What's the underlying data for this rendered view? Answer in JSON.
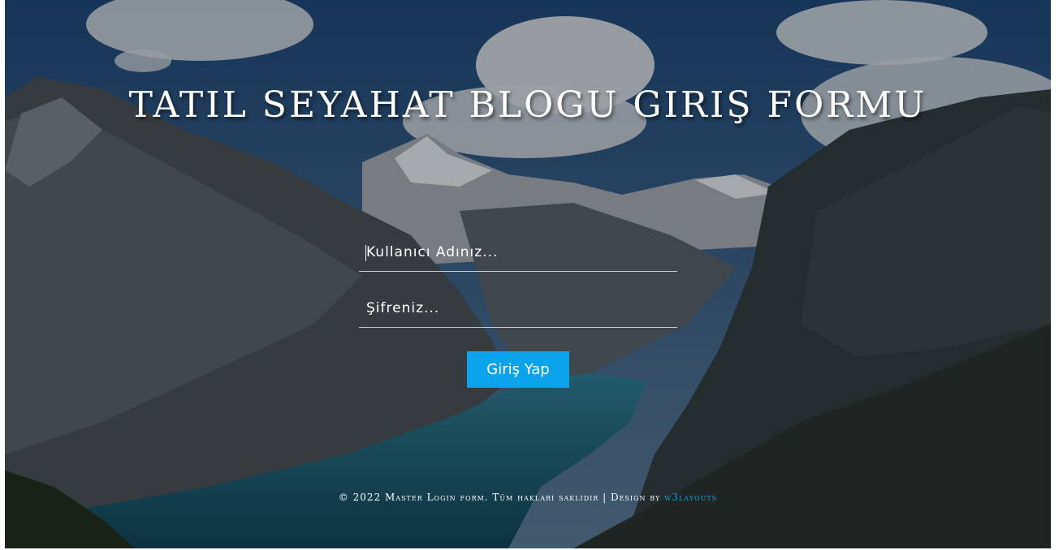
{
  "page": {
    "title": "TATIL SEYAHAT BLOGU GIRIŞ FORMU"
  },
  "login_form": {
    "username_placeholder": "Kullanıcı Adınız...",
    "password_placeholder": "Şifreniz...",
    "submit_label": "Giriş Yap"
  },
  "footer": {
    "copyright": "© 2022 Master Login form. Tüm hakları saklıdır | Design by ",
    "link_label": "w3layouts"
  },
  "colors": {
    "accent": "#0aa3ec",
    "text": "#ffffff"
  },
  "background": {
    "scene": "mountain-lake-photo"
  }
}
